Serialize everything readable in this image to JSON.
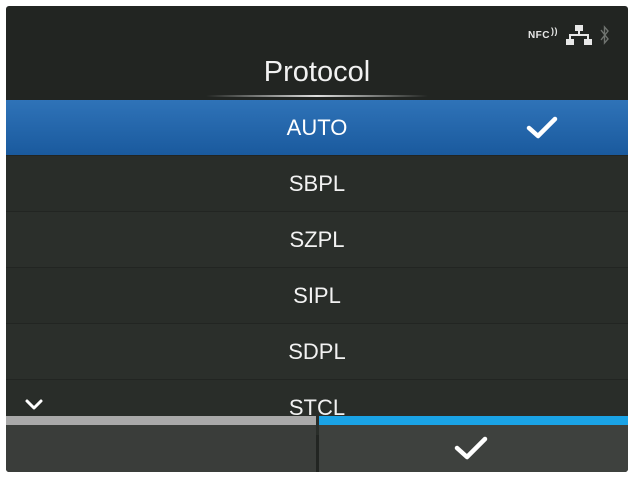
{
  "screen": {
    "title": "Protocol",
    "status_icons": {
      "nfc_label": "NFC",
      "nfc_waves": "))",
      "network": "network-icon",
      "bluetooth": "bluetooth-icon"
    },
    "items": [
      {
        "label": "AUTO",
        "selected": true
      },
      {
        "label": "SBPL",
        "selected": false
      },
      {
        "label": "SZPL",
        "selected": false
      },
      {
        "label": "SIPL",
        "selected": false
      },
      {
        "label": "SDPL",
        "selected": false
      },
      {
        "label": "STCL",
        "selected": false
      }
    ],
    "colors": {
      "selected_row": "#2a6cb2",
      "confirm_key_bar": "#1aa3e6",
      "back_key_bar": "#a9a9a9",
      "background": "#222522"
    },
    "softkeys": {
      "left": "blank-key",
      "right": "check-icon"
    }
  }
}
